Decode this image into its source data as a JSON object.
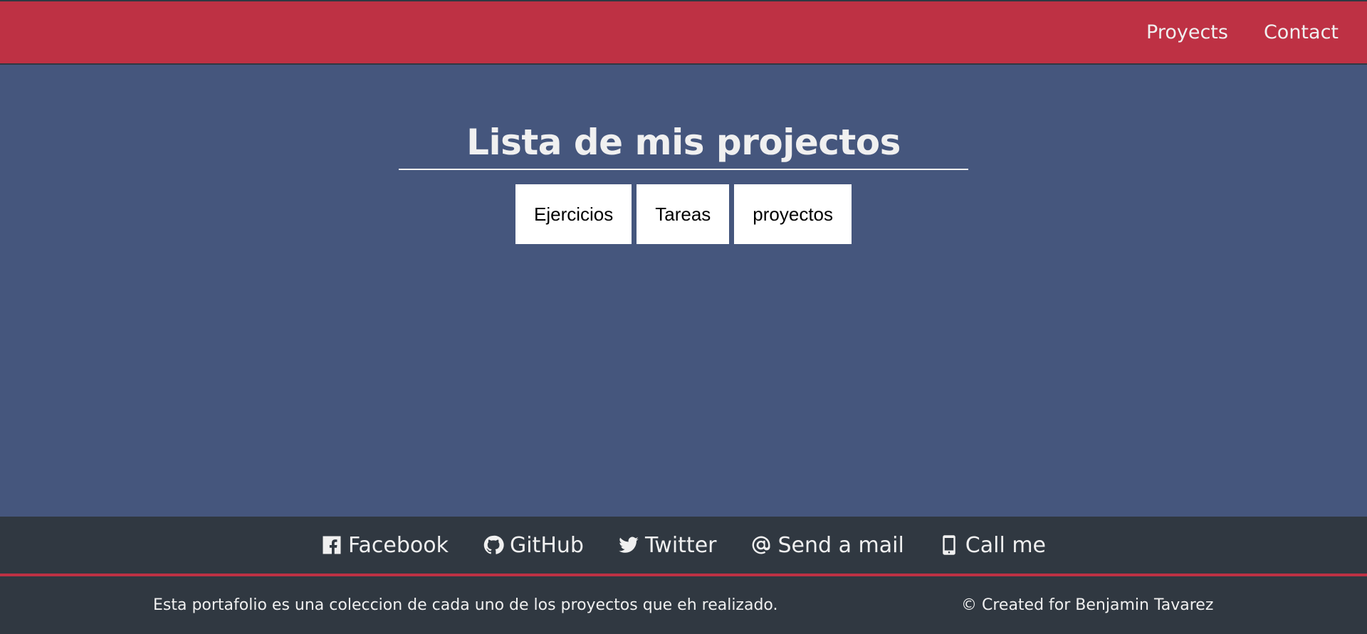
{
  "nav": {
    "links": [
      "Proyects",
      "Contact"
    ]
  },
  "main": {
    "title": "Lista de mis projectos",
    "buttons": [
      "Ejercicios",
      "Tareas",
      "proyectos"
    ]
  },
  "social": {
    "links": [
      {
        "label": "Facebook",
        "icon": "facebook-icon"
      },
      {
        "label": "GitHub",
        "icon": "github-icon"
      },
      {
        "label": "Twitter",
        "icon": "twitter-icon"
      },
      {
        "label": "Send a mail",
        "icon": "at-sign-icon"
      },
      {
        "label": "Call me",
        "icon": "mobile-phone-icon"
      }
    ]
  },
  "footer": {
    "description": "Esta portafolio es una coleccion de cada uno de los proyectos que eh realizado.",
    "credit": "© Created for Benjamin Tavarez"
  },
  "colors": {
    "navbar": "#be3144",
    "background": "#45567d",
    "footer": "#303841",
    "text": "#f0f0f0"
  }
}
